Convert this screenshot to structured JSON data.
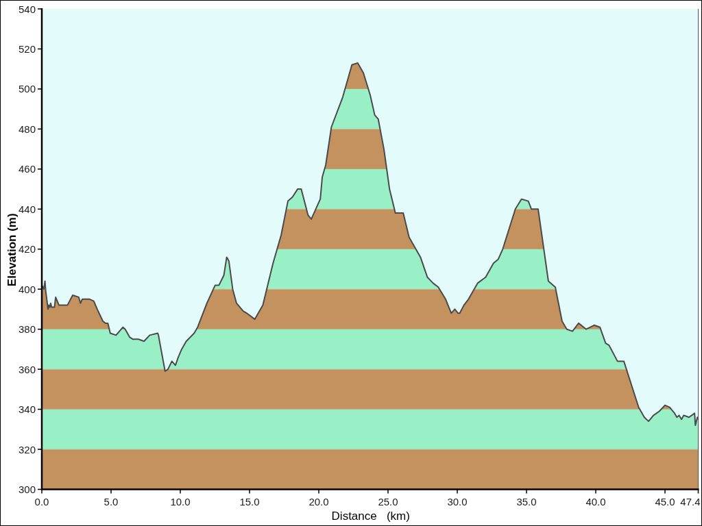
{
  "elevation_profile": {
    "chart_data": {
      "type": "area",
      "xlabel": "Distance   (km)",
      "ylabel": "Elevation (m)",
      "x": [
        0,
        0.15,
        0.23,
        0.28,
        0.45,
        0.5,
        0.58,
        0.64,
        0.71,
        0.91,
        1.0,
        1.24,
        1.85,
        2.23,
        2.67,
        2.79,
        2.92,
        3.45,
        3.75,
        4.0,
        4.41,
        4.6,
        4.77,
        4.94,
        5.36,
        5.86,
        6.02,
        6.35,
        6.58,
        6.97,
        7.38,
        7.79,
        8.37,
        8.42,
        8.9,
        9.11,
        9.39,
        9.65,
        9.85,
        10.1,
        10.43,
        11.0,
        11.25,
        11.92,
        12.52,
        12.79,
        13.15,
        13.35,
        13.51,
        13.78,
        14.06,
        14.55,
        14.8,
        15.38,
        15.96,
        16.7,
        17.28,
        17.77,
        18.1,
        18.47,
        18.73,
        19.22,
        19.46,
        20.11,
        20.25,
        20.5,
        20.91,
        21.73,
        22.39,
        22.81,
        23.22,
        23.71,
        24.04,
        24.29,
        24.7,
        25.11,
        25.53,
        26.1,
        26.52,
        27.01,
        27.34,
        27.84,
        28.25,
        28.63,
        29.16,
        29.57,
        29.82,
        30.06,
        30.18,
        30.48,
        30.81,
        31.47,
        32.05,
        32.62,
        32.96,
        33.28,
        34.19,
        34.64,
        35.13,
        35.35,
        35.84,
        36.58,
        37.08,
        37.57,
        37.91,
        38.32,
        38.76,
        39.31,
        39.89,
        40.3,
        40.71,
        40.96,
        41.57,
        42.03,
        43.1,
        43.51,
        43.81,
        44.17,
        44.59,
        45.0,
        45.33,
        45.69,
        45.86,
        46.02,
        46.19,
        46.35,
        46.73,
        47.14,
        47.19,
        47.34,
        47.4
      ],
      "values": [
        402,
        400,
        404,
        399,
        390,
        392,
        391,
        393,
        391,
        391,
        396,
        392,
        392,
        397,
        396,
        393,
        395,
        395,
        394,
        390,
        384,
        383,
        383,
        378,
        377,
        381,
        380,
        376,
        375,
        375,
        374,
        377,
        378,
        377,
        359,
        360,
        364,
        362,
        366,
        370,
        374,
        378,
        381,
        393,
        402,
        402,
        407,
        416,
        414,
        400,
        393,
        389,
        388,
        385,
        392,
        413,
        427,
        444,
        446,
        450,
        450,
        437,
        435,
        445,
        456,
        462,
        481,
        496,
        512,
        513,
        508,
        497,
        487,
        485,
        470,
        450,
        438,
        438,
        426,
        420,
        416,
        406,
        403,
        401,
        395,
        388,
        390,
        388,
        388,
        392,
        395,
        403,
        406,
        413,
        415,
        420,
        440,
        445,
        444,
        440,
        440,
        404,
        401,
        384,
        380,
        379,
        383,
        380,
        382,
        381,
        373,
        372,
        364,
        364,
        341,
        336,
        334,
        337,
        339,
        342,
        341,
        338,
        336,
        337,
        335,
        337,
        336,
        338,
        332,
        336,
        335
      ],
      "xlim": [
        0,
        47.4
      ],
      "ylim": [
        300,
        540
      ],
      "xticks": [
        {
          "value": 0,
          "label": "0.0"
        },
        {
          "value": 5,
          "label": "5.0"
        },
        {
          "value": 10,
          "label": "10.0"
        },
        {
          "value": 15,
          "label": "15.0"
        },
        {
          "value": 20,
          "label": "20.0"
        },
        {
          "value": 25,
          "label": "25.0"
        },
        {
          "value": 30,
          "label": "30.0"
        },
        {
          "value": 35,
          "label": "35.0"
        },
        {
          "value": 40,
          "label": "40.0"
        },
        {
          "value": 45,
          "label": "45.0"
        },
        {
          "value": 47.4,
          "label": "47.4"
        }
      ],
      "yticks": [
        300,
        320,
        340,
        360,
        380,
        400,
        420,
        440,
        460,
        480,
        500,
        520,
        540
      ]
    }
  }
}
